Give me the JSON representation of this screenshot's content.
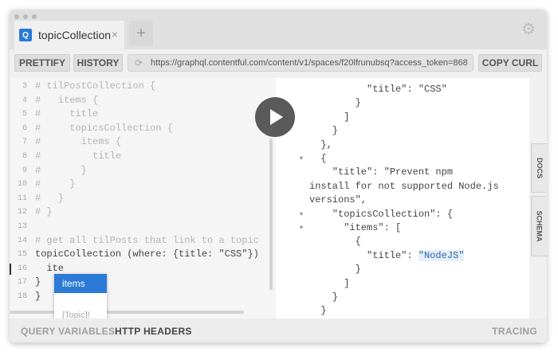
{
  "tab": {
    "icon": "Q",
    "title": "topicCollection",
    "close": "×"
  },
  "add_tab": "+",
  "toolbar": {
    "prettify": "PRETTIFY",
    "history": "HISTORY",
    "url": "https://graphql.contentful.com/content/v1/spaces/f20lfrunubsq?access_token=868",
    "copy_curl": "COPY CURL"
  },
  "editor_lines": [
    {
      "n": "3",
      "text": "# tilPostCollection {",
      "cls": "cm"
    },
    {
      "n": "4",
      "text": "#   items {",
      "cls": "cm"
    },
    {
      "n": "5",
      "text": "#     title",
      "cls": "cm"
    },
    {
      "n": "6",
      "text": "#     topicsCollection {",
      "cls": "cm"
    },
    {
      "n": "7",
      "text": "#       items {",
      "cls": "cm"
    },
    {
      "n": "8",
      "text": "#         title",
      "cls": "cm"
    },
    {
      "n": "9",
      "text": "#       }",
      "cls": "cm"
    },
    {
      "n": "10",
      "text": "#     }",
      "cls": "cm"
    },
    {
      "n": "11",
      "text": "#   }",
      "cls": "cm"
    },
    {
      "n": "12",
      "text": "# }",
      "cls": "cm"
    },
    {
      "n": "13",
      "text": "",
      "cls": "kw"
    },
    {
      "n": "14",
      "text": "# get all tilPosts that link to a topic",
      "cls": "cm"
    },
    {
      "n": "15",
      "text": "topicCollection (where: {title: \"CSS\"})",
      "cls": "kw"
    },
    {
      "n": "16",
      "text": "  ite",
      "cls": "kw"
    },
    {
      "n": "17",
      "text": "}",
      "cls": "kw"
    },
    {
      "n": "18",
      "text": "}",
      "cls": "kw"
    }
  ],
  "autocomplete": {
    "item": "items",
    "type": "[Topic]!"
  },
  "result_lines": [
    {
      "text": "          \"title\": \"CSS\"",
      "fold": "",
      "hl": ""
    },
    {
      "text": "        }",
      "fold": "",
      "hl": ""
    },
    {
      "text": "      ]",
      "fold": "",
      "hl": ""
    },
    {
      "text": "    }",
      "fold": "",
      "hl": ""
    },
    {
      "text": "  },",
      "fold": "",
      "hl": ""
    },
    {
      "text": "  {",
      "fold": "▾",
      "hl": ""
    },
    {
      "text": "    \"title\": \"Prevent npm",
      "fold": "",
      "hl": ""
    },
    {
      "text": "install for not supported Node.js",
      "fold": "",
      "hl": ""
    },
    {
      "text": "versions\",",
      "fold": "",
      "hl": ""
    },
    {
      "text": "    \"topicsCollection\": {",
      "fold": "▾",
      "hl": ""
    },
    {
      "text": "      \"items\": [",
      "fold": "▾",
      "hl": ""
    },
    {
      "text": "        {",
      "fold": "",
      "hl": ""
    },
    {
      "text": "          \"title\": ",
      "fold": "",
      "hl": "\"NodeJS\""
    },
    {
      "text": "        }",
      "fold": "",
      "hl": ""
    },
    {
      "text": "      ]",
      "fold": "",
      "hl": ""
    },
    {
      "text": "    }",
      "fold": "",
      "hl": ""
    },
    {
      "text": "  }",
      "fold": "",
      "hl": ""
    }
  ],
  "side_tabs": {
    "docs": "DOCS",
    "schema": "SCHEMA"
  },
  "bottom": {
    "query_variables": "QUERY VARIABLES",
    "http_headers": "HTTP HEADERS",
    "tracing": "TRACING"
  },
  "colors": {
    "accent": "#2a7ad6",
    "play": "#5a5a5a"
  }
}
